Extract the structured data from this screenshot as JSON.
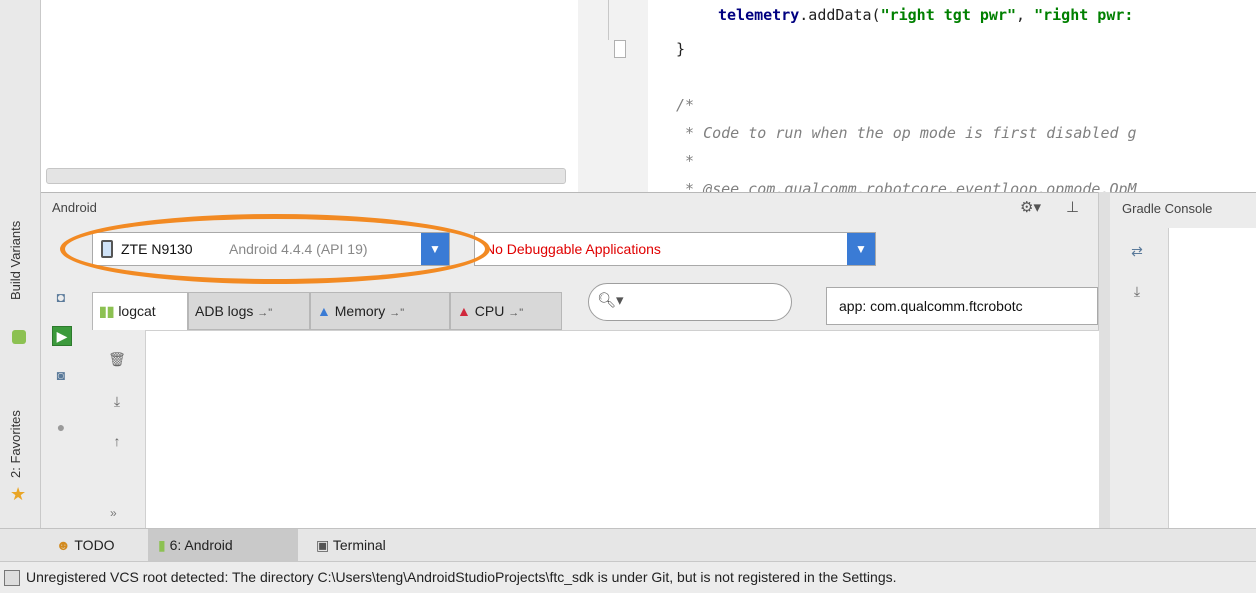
{
  "left_strip": {
    "build_variants_label": "Build Variants",
    "favorites_label": "2: Favorites"
  },
  "editor": {
    "code_lines": [
      {
        "prefix": "telemetry",
        "mid": ".addData(",
        "s1": "\"right tgt pwr\"",
        "sep": ", ",
        "s2": "\"right pwr:"
      },
      {
        "text": "}"
      },
      {
        "text": "/*"
      },
      {
        "text": " * Code to run when the op mode is first disabled g"
      },
      {
        "text": " *"
      },
      {
        "text": " * @see com.qualcomm.robotcore.eventloop.opmode.OpM"
      }
    ]
  },
  "android_panel": {
    "title": "Android",
    "device_name": "ZTE N9130",
    "device_detail": "Android 4.4.4 (API 19)",
    "app_selector": "No Debuggable Applications",
    "tabs": [
      {
        "label": "logcat"
      },
      {
        "label": "ADB logs"
      },
      {
        "label": "Memory"
      },
      {
        "label": "CPU"
      }
    ],
    "tab_arrow": "→\"",
    "search_placeholder": "",
    "filter_value": "app: com.qualcomm.ftcrobotc",
    "more_label": "»"
  },
  "gradle_console": {
    "title": "Gradle Console"
  },
  "bottom_tabs": [
    {
      "label": "TODO"
    },
    {
      "label": "6: Android"
    },
    {
      "label": "Terminal"
    }
  ],
  "status_bar": {
    "message": "Unregistered VCS root detected: The directory C:\\Users\\teng\\AndroidStudioProjects\\ftc_sdk is under Git, but is not registered in the Settings."
  },
  "colors": {
    "highlight": "#f28a23",
    "error_text": "#e00000",
    "dropdown": "#3a7bd5"
  }
}
